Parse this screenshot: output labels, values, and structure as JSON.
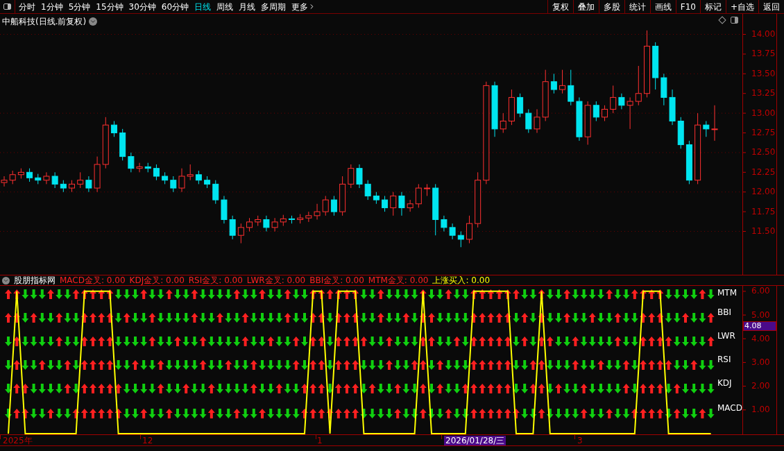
{
  "toolbar": {
    "periods": [
      {
        "label": "分时",
        "selected": false
      },
      {
        "label": "1分钟",
        "selected": false
      },
      {
        "label": "5分钟",
        "selected": false
      },
      {
        "label": "15分钟",
        "selected": false
      },
      {
        "label": "30分钟",
        "selected": false
      },
      {
        "label": "60分钟",
        "selected": false
      },
      {
        "label": "日线",
        "selected": true
      },
      {
        "label": "周线",
        "selected": false
      },
      {
        "label": "月线",
        "selected": false
      },
      {
        "label": "多周期",
        "selected": false
      }
    ],
    "more": "更多",
    "actions": [
      "复权",
      "叠加",
      "多股",
      "统计",
      "画线",
      "F10",
      "标记",
      "+自选",
      "返回"
    ]
  },
  "main_chart": {
    "title": "中船科技(日线.前复权)",
    "chart_data": {
      "type": "candlestick",
      "yticks": [
        {
          "value": 14,
          "label": "14.00"
        },
        {
          "value": 13.75,
          "label": "13.75"
        },
        {
          "value": 13.5,
          "label": "13.50"
        },
        {
          "value": 13.25,
          "label": "13.25"
        },
        {
          "value": 13,
          "label": "13.00"
        },
        {
          "value": 12.75,
          "label": "12.75"
        },
        {
          "value": 12.5,
          "label": "12.50"
        },
        {
          "value": 12.25,
          "label": "12.25"
        },
        {
          "value": 12,
          "label": "12.00"
        },
        {
          "value": 11.75,
          "label": "11.75"
        },
        {
          "value": 11.5,
          "label": "11.50"
        }
      ],
      "ylim": [
        10.95,
        14.26
      ],
      "grid": true,
      "categories": [
        null,
        null,
        null,
        null,
        null,
        null,
        null,
        null,
        null,
        null,
        null,
        null,
        null,
        null,
        null,
        null,
        null,
        null,
        null,
        null,
        null,
        null,
        null,
        null,
        null,
        null,
        null,
        null,
        null,
        null,
        null,
        null,
        null,
        null,
        null,
        null,
        null,
        null,
        null,
        null,
        null,
        null,
        null,
        null,
        null,
        null,
        null,
        null,
        null,
        null,
        null,
        null,
        null,
        null,
        null,
        null,
        null,
        null,
        null,
        null,
        null,
        null,
        null,
        null,
        null,
        null,
        null,
        null,
        null,
        null,
        null,
        null,
        null,
        null,
        null,
        null,
        null,
        null,
        null,
        null,
        null,
        null,
        null,
        null,
        null
      ],
      "ohlc": [
        [
          12.12,
          12.2,
          12.07,
          12.15
        ],
        [
          12.15,
          12.27,
          12.1,
          12.22
        ],
        [
          12.22,
          12.3,
          12.17,
          12.25
        ],
        [
          12.25,
          12.3,
          12.13,
          12.18
        ],
        [
          12.18,
          12.23,
          12.1,
          12.15
        ],
        [
          12.15,
          12.25,
          12.1,
          12.2
        ],
        [
          12.2,
          12.25,
          12.05,
          12.1
        ],
        [
          12.1,
          12.15,
          12,
          12.05
        ],
        [
          12.05,
          12.15,
          12,
          12.1
        ],
        [
          12.1,
          12.25,
          12.05,
          12.15
        ],
        [
          12.15,
          12.2,
          12,
          12.05
        ],
        [
          12.05,
          12.45,
          12,
          12.35
        ],
        [
          12.35,
          12.95,
          12.3,
          12.85
        ],
        [
          12.85,
          12.9,
          12.7,
          12.75
        ],
        [
          12.75,
          12.8,
          12.4,
          12.45
        ],
        [
          12.45,
          12.5,
          12.25,
          12.3
        ],
        [
          12.3,
          12.37,
          12.25,
          12.32
        ],
        [
          12.32,
          12.37,
          12.25,
          12.3
        ],
        [
          12.3,
          12.35,
          12.15,
          12.2
        ],
        [
          12.2,
          12.25,
          12.1,
          12.15
        ],
        [
          12.15,
          12.2,
          12,
          12.05
        ],
        [
          12.05,
          12.3,
          12,
          12.2
        ],
        [
          12.2,
          12.35,
          12.15,
          12.22
        ],
        [
          12.22,
          12.27,
          12.1,
          12.15
        ],
        [
          12.15,
          12.2,
          12.05,
          12.1
        ],
        [
          12.1,
          12.15,
          11.85,
          11.9
        ],
        [
          11.9,
          11.95,
          11.6,
          11.65
        ],
        [
          11.65,
          11.7,
          11.4,
          11.45
        ],
        [
          11.45,
          11.6,
          11.35,
          11.55
        ],
        [
          11.55,
          11.67,
          11.5,
          11.62
        ],
        [
          11.62,
          11.7,
          11.57,
          11.65
        ],
        [
          11.65,
          11.7,
          11.5,
          11.55
        ],
        [
          11.55,
          11.67,
          11.5,
          11.62
        ],
        [
          11.62,
          11.71,
          11.57,
          11.66
        ],
        [
          11.66,
          11.7,
          11.6,
          11.65
        ],
        [
          11.65,
          11.72,
          11.6,
          11.67
        ],
        [
          11.67,
          11.75,
          11.62,
          11.7
        ],
        [
          11.7,
          11.85,
          11.65,
          11.75
        ],
        [
          11.75,
          11.95,
          11.7,
          11.9
        ],
        [
          11.9,
          11.95,
          11.7,
          11.75
        ],
        [
          11.75,
          12.2,
          11.7,
          12.1
        ],
        [
          12.1,
          12.35,
          12.05,
          12.3
        ],
        [
          12.3,
          12.35,
          12.05,
          12.1
        ],
        [
          12.1,
          12.15,
          11.9,
          11.95
        ],
        [
          11.95,
          12,
          11.85,
          11.9
        ],
        [
          11.9,
          11.95,
          11.75,
          11.8
        ],
        [
          11.8,
          12,
          11.7,
          11.95
        ],
        [
          11.95,
          12,
          11.7,
          11.8
        ],
        [
          11.8,
          11.9,
          11.75,
          11.85
        ],
        [
          11.85,
          12.1,
          11.8,
          12.05
        ],
        [
          12.05,
          12.1,
          11.95,
          12.05
        ],
        [
          12.05,
          12.1,
          11.45,
          11.65
        ],
        [
          11.65,
          11.7,
          11.5,
          11.55
        ],
        [
          11.55,
          11.6,
          11.4,
          11.45
        ],
        [
          11.45,
          11.5,
          11.3,
          11.4
        ],
        [
          11.4,
          11.7,
          11.35,
          11.6
        ],
        [
          11.6,
          12.25,
          11.55,
          12.15
        ],
        [
          12.15,
          13.4,
          12.1,
          13.35
        ],
        [
          13.35,
          13.4,
          12.7,
          12.8
        ],
        [
          12.8,
          13,
          12.75,
          12.9
        ],
        [
          12.9,
          13.3,
          12.85,
          13.2
        ],
        [
          13.2,
          13.25,
          12.95,
          13
        ],
        [
          13,
          13.05,
          12.75,
          12.8
        ],
        [
          12.8,
          13.05,
          12.75,
          12.95
        ],
        [
          12.95,
          13.55,
          12.9,
          13.4
        ],
        [
          13.4,
          13.5,
          13.25,
          13.3
        ],
        [
          13.3,
          13.55,
          13.25,
          13.35
        ],
        [
          13.35,
          13.55,
          13.1,
          13.15
        ],
        [
          13.15,
          13.2,
          12.65,
          12.7
        ],
        [
          12.7,
          13.15,
          12.6,
          13.1
        ],
        [
          13.1,
          13.15,
          12.9,
          12.95
        ],
        [
          12.95,
          13.1,
          12.9,
          13.05
        ],
        [
          13.05,
          13.35,
          13,
          13.2
        ],
        [
          13.2,
          13.25,
          13.05,
          13.1
        ],
        [
          13.1,
          13.2,
          12.8,
          13.15
        ],
        [
          13.15,
          13.6,
          13.1,
          13.25
        ],
        [
          13.25,
          14.05,
          13.2,
          13.85
        ],
        [
          13.85,
          13.9,
          13.3,
          13.45
        ],
        [
          13.45,
          13.5,
          13.1,
          13.2
        ],
        [
          13.2,
          13.3,
          12.85,
          12.9
        ],
        [
          12.9,
          12.95,
          12.55,
          12.6
        ],
        [
          12.6,
          12.65,
          12.1,
          12.15
        ],
        [
          12.15,
          13,
          12.1,
          12.85
        ],
        [
          12.85,
          12.9,
          12.7,
          12.8
        ],
        [
          12.8,
          13.1,
          12.65,
          12.8
        ]
      ]
    }
  },
  "indicator": {
    "name": "股朋指标网",
    "readouts": [
      {
        "label": "MACD金叉: 0.00",
        "color": "#ff2020"
      },
      {
        "label": "KDJ金叉: 0.00",
        "color": "#ff2020"
      },
      {
        "label": "RSI金叉: 0.00",
        "color": "#ff2020"
      },
      {
        "label": "LWR金叉: 0.00",
        "color": "#ff2020"
      },
      {
        "label": "BBI金叉: 0.00",
        "color": "#ff2020"
      },
      {
        "label": "MTM金叉: 0.00",
        "color": "#ff2020"
      },
      {
        "label": "上涨买入: 0.00",
        "color": "#ffff00"
      }
    ],
    "signal_labels": [
      "MTM",
      "BBI",
      "LWR",
      "RSI",
      "KDJ",
      "MACD"
    ],
    "chart_data": {
      "type": "line",
      "ylim": [
        -0.06,
        6.23
      ],
      "categories": [
        null,
        null,
        null,
        null,
        null,
        null,
        null,
        null,
        null,
        null,
        null,
        null,
        null,
        null,
        null,
        null,
        null,
        null,
        null,
        null,
        null,
        null,
        null,
        null,
        null,
        null,
        null,
        null,
        null,
        null,
        null,
        null,
        null,
        null,
        null,
        null,
        null,
        null,
        null,
        null,
        null,
        null,
        null,
        null,
        null,
        null,
        null,
        null,
        null,
        null,
        null,
        null,
        null,
        null,
        null,
        null,
        null,
        null,
        null,
        null,
        null,
        null,
        null,
        null,
        null,
        null,
        null,
        null,
        null,
        null,
        null,
        null,
        null,
        null,
        null,
        null,
        null,
        null,
        null,
        null,
        null,
        null,
        null,
        null
      ],
      "yticks": [
        {
          "value": 6,
          "label": "6.00"
        },
        {
          "value": 5,
          "label": "5.00"
        },
        {
          "value": 4,
          "label": "4.00"
        },
        {
          "value": 3,
          "label": "3.00"
        },
        {
          "value": 2,
          "label": "2.00"
        },
        {
          "value": 1,
          "label": "1.00"
        }
      ],
      "series": [
        {
          "color": "#ffff00",
          "values": [
            0,
            6,
            0,
            0,
            0,
            0,
            0,
            0,
            0,
            6,
            6,
            6,
            6,
            0,
            0,
            0,
            0,
            0,
            0,
            0,
            0,
            0,
            0,
            0,
            0,
            0,
            0,
            0,
            0,
            0,
            0,
            0,
            0,
            0,
            0,
            0,
            6,
            6,
            0,
            6,
            6,
            6,
            0,
            0,
            0,
            0,
            0,
            0,
            0,
            6,
            0,
            0,
            0,
            0,
            0,
            6,
            6,
            6,
            6,
            6,
            0,
            0,
            0,
            6,
            0,
            0,
            0,
            0,
            0,
            0,
            0,
            0,
            0,
            0,
            0,
            6,
            6,
            6,
            0,
            0,
            0,
            0,
            0,
            0
          ]
        }
      ]
    },
    "current_value": "4.08"
  },
  "time_axis": {
    "labels": [
      {
        "label": "2025年",
        "selected": false
      },
      {
        "label": "12",
        "selected": false
      },
      {
        "label": "1",
        "selected": false
      },
      {
        "label": "2026/01/28/三",
        "selected": true
      },
      {
        "label": "3",
        "selected": false
      }
    ]
  }
}
